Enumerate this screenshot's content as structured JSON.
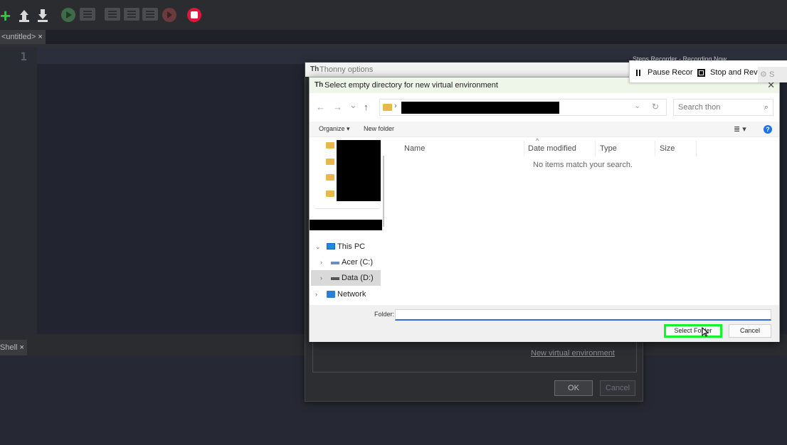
{
  "toolbar": {
    "icons": [
      "new-file-icon",
      "load-icon",
      "save-icon",
      "run-icon",
      "debug-icon",
      "step-over-icon",
      "step-into-icon",
      "step-out-icon",
      "resume-icon",
      "stop-icon"
    ],
    "colors": {
      "new": "#36c24a",
      "stop": "#e0173d"
    }
  },
  "editor": {
    "tab_label": "<untitled>",
    "tab_close": "×",
    "line_number": "1"
  },
  "shell": {
    "tab_label": "Shell",
    "tab_close": "×"
  },
  "options_dialog": {
    "title": "Thonny options",
    "title_icon": "Th",
    "new_venv_link": "New virtual environment",
    "ok_label": "OK",
    "cancel_label": "Cancel"
  },
  "file_dialog": {
    "title": "Select empty directory for new virtual environment",
    "title_icon": "Th",
    "close": "✕",
    "nav": {
      "back": "←",
      "forward": "→",
      "recent": "⌄",
      "up": "↑"
    },
    "address_chevron": "›",
    "address_dropdown": "⌄",
    "refresh": "↻",
    "search_placeholder": "Search thon",
    "search_icon": "⌕",
    "organize_label": "Organize ▾",
    "new_folder_label": "New folder",
    "view_label": "≣ ▾",
    "help_label": "?",
    "columns": [
      "Name",
      "Date modified",
      "Type",
      "Size"
    ],
    "sort_caret": "^",
    "empty_message": "No items match your search.",
    "tree": [
      {
        "chevron": "⌄",
        "label": "This PC",
        "icon": "pc-icon"
      },
      {
        "chevron": "›",
        "label": "Acer (C:)",
        "icon": "drive-icon"
      },
      {
        "chevron": "›",
        "label": "Data (D:)",
        "icon": "drive-icon",
        "selected": true
      },
      {
        "chevron": "›",
        "label": "Network",
        "icon": "network-icon"
      }
    ],
    "folder_label": "Folder:",
    "folder_value": "",
    "select_folder_label": "Select Folder",
    "cancel_label": "Cancel",
    "highlight_color": "#14f529"
  },
  "recorder": {
    "title": "Steps Recorder - Recording Now",
    "pause_label": "Pause Recor",
    "stop_label": "Stop and Rev",
    "settings_label": "S"
  }
}
